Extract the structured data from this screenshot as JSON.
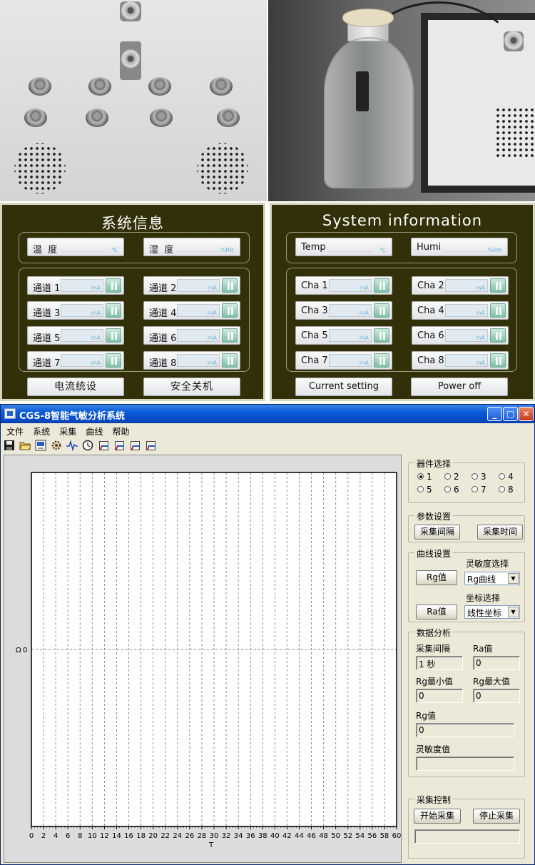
{
  "panel_cn": {
    "title": "系统信息",
    "temp_label": "温  度",
    "temp_unit": "℃",
    "humi_label": "湿  度",
    "humi_unit": "%RH",
    "channels": [
      "通道 1",
      "通道 2",
      "通道 3",
      "通道 4",
      "通道 5",
      "通道 6",
      "通道 7",
      "通道 8"
    ],
    "channel_unit": "mA",
    "current_setting": "电流统设",
    "power_off": "安全关机"
  },
  "panel_en": {
    "title": "System information",
    "temp_label": "Temp",
    "temp_unit": "℃",
    "humi_label": "Humi",
    "humi_unit": "%RH",
    "channels": [
      "Cha 1",
      "Cha 2",
      "Cha 3",
      "Cha 4",
      "Cha 5",
      "Cha 6",
      "Cha 7",
      "Cha 8"
    ],
    "channel_unit": "mA",
    "current_setting": "Current setting",
    "power_off": "Power off"
  },
  "window": {
    "title": "CGS-8智能气敏分析系统",
    "minimize": "_",
    "maximize": "□",
    "close": "✕",
    "menu": [
      "文件",
      "系统",
      "采集",
      "曲线",
      "帮助"
    ],
    "toolbar_icons": [
      "save-icon",
      "open-icon",
      "export-icon",
      "settings-icon",
      "waveform-icon",
      "clock-icon",
      "chart1-icon",
      "chart2-icon",
      "chart3-icon",
      "chart4-icon"
    ]
  },
  "chart_data": {
    "type": "line",
    "xlabel": "T",
    "ylabel": "Ω",
    "x_ticks": [
      "0",
      "2",
      "4",
      "6",
      "8",
      "10",
      "12",
      "14",
      "16",
      "18",
      "20",
      "22",
      "24",
      "26",
      "28",
      "30",
      "32",
      "34",
      "36",
      "38",
      "40",
      "42",
      "44",
      "46",
      "48",
      "50",
      "52",
      "54",
      "56",
      "58",
      "60"
    ],
    "y_ticks": [
      "0"
    ],
    "xlim": [
      0,
      60
    ],
    "grid": "vertical dashed",
    "series": []
  },
  "controls": {
    "device_select": {
      "legend": "器件选择",
      "options": [
        "1",
        "2",
        "3",
        "4",
        "5",
        "6",
        "7",
        "8"
      ],
      "selected": "1"
    },
    "params": {
      "legend": "参数设置",
      "interval_btn": "采集间隔",
      "time_btn": "采集时间"
    },
    "curve": {
      "legend": "曲线设置",
      "sensitivity_label": "灵敏度选择",
      "rg_btn": "Rg值",
      "rg_combo": "Rg曲线",
      "coord_label": "坐标选择",
      "ra_btn": "Ra值",
      "coord_combo": "线性坐标"
    },
    "analysis": {
      "legend": "数据分析",
      "interval_label": "采集间隔",
      "interval_value": "1 秒",
      "ra_label": "Ra值",
      "ra_value": "0",
      "rg_min_label": "Rg最小值",
      "rg_min_value": "0",
      "rg_max_label": "Rg最大值",
      "rg_max_value": "0",
      "rg_label": "Rg值",
      "rg_value": "0",
      "sensitivity_label": "灵敏度值",
      "sensitivity_value": ""
    },
    "acquisition": {
      "legend": "采集控制",
      "start_btn": "开始采集",
      "stop_btn": "停止采集",
      "status": ""
    }
  }
}
